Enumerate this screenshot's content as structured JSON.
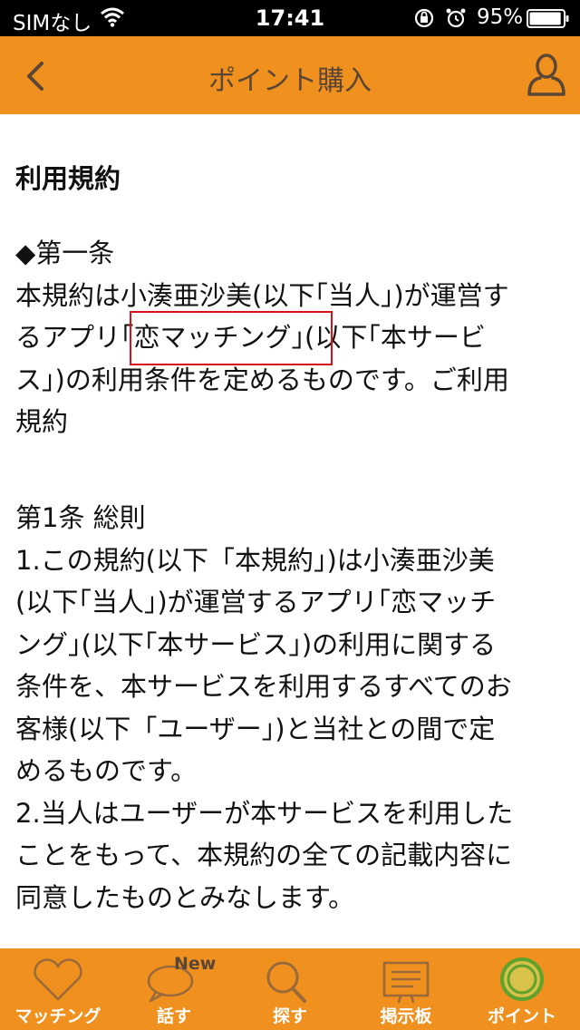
{
  "status_bar": {
    "carrier": "SIMなし",
    "time": "17:41",
    "battery_percent": "95%",
    "battery_level": 0.95,
    "icons": [
      "wifi-icon",
      "orientation-lock-icon",
      "alarm-icon",
      "battery-icon"
    ]
  },
  "nav": {
    "title": "ポイント購入",
    "back_icon": "chevron-left-icon",
    "profile_icon": "person-icon"
  },
  "content": {
    "heading": "利用規約",
    "intro_lines": [
      "◆第一条",
      "本規約は小湊亜沙美(以下｢当人｣)が運営す",
      "るアプリ｢恋マッチング｣(以下｢本サービ",
      "ス｣)の利用条件を定めるものです。ご利用",
      "規約"
    ],
    "highlighted_text": "｢恋マッチング｣",
    "article_lines": [
      "第1条 総則",
      "1.この規約(以下「本規約」)は小湊亜沙美",
      "(以下｢当人｣)が運営するアプリ｢恋マッチ",
      "ング｣(以下｢本サービス｣)の利用に関する",
      "条件を、本サービスを利用するすべてのお",
      "客様(以下「ユーザー」)と当社との間で定",
      "めるものです。",
      "2.当人はユーザーが本サービスを利用した",
      "ことをもって、本規約の全ての記載内容に",
      "同意したものとみなします。"
    ]
  },
  "tabs": [
    {
      "label": "マッチング",
      "icon": "heart-icon",
      "active": false
    },
    {
      "label": "話す",
      "icon": "speech-bubble-icon",
      "badge": "New",
      "active": false
    },
    {
      "label": "探す",
      "icon": "magnifier-icon",
      "active": false
    },
    {
      "label": "掲示板",
      "icon": "bulletin-board-icon",
      "active": false
    },
    {
      "label": "ポイント",
      "icon": "coin-icon",
      "active": true
    }
  ],
  "colors": {
    "accent": "#f0901f",
    "nav_text": "#5a4634",
    "highlight_border": "#d9111b",
    "active_icon": "#5fa22c"
  }
}
